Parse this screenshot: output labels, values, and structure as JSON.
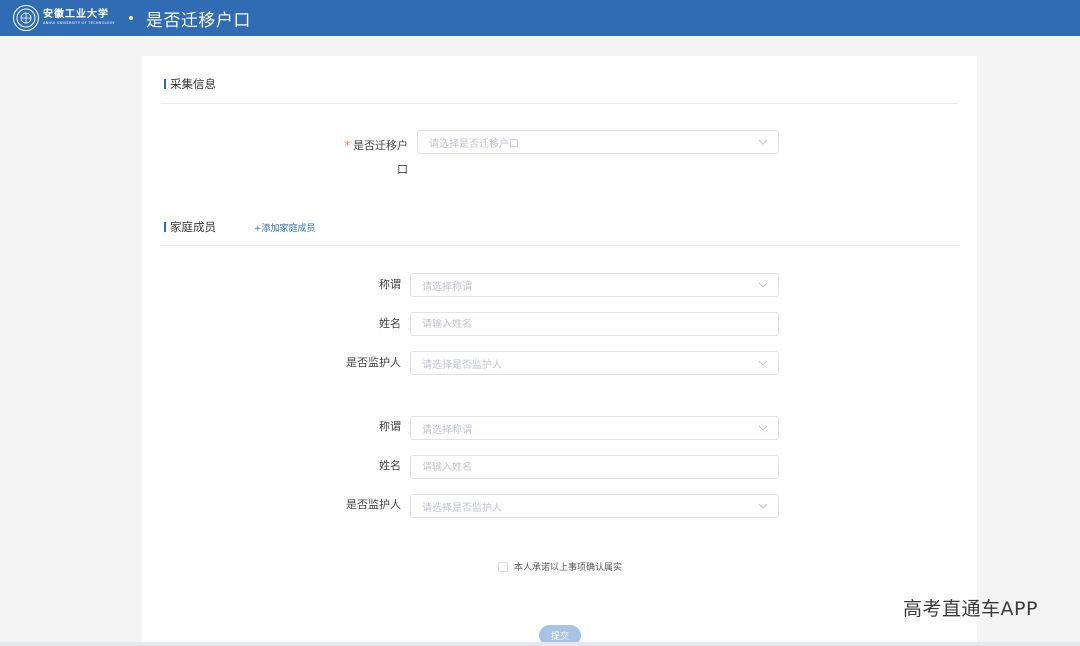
{
  "header": {
    "logo_cn": "安徽工业大学",
    "logo_en": "ANHUI UNIVERSITY OF TECHNOLOGY",
    "title": "是否迁移户口",
    "bg_color": "#2f6cb4"
  },
  "collect": {
    "section_title": "采集信息",
    "migrate_label": "是否迁移户口",
    "migrate_placeholder": "请选择是否迁移户口"
  },
  "family": {
    "section_title": "家庭成员",
    "add_link": "+添加家庭成员",
    "members": [
      {
        "relation_label": "称谓",
        "relation_placeholder": "请选择称谓",
        "name_label": "姓名",
        "name_placeholder": "请输入姓名",
        "guardian_label": "是否监护人",
        "guardian_placeholder": "请选择是否监护人"
      },
      {
        "relation_label": "称谓",
        "relation_placeholder": "请选择称谓",
        "name_label": "姓名",
        "name_placeholder": "请输入姓名",
        "guardian_label": "是否监护人",
        "guardian_placeholder": "请选择是否监护人"
      }
    ]
  },
  "agreement": {
    "text": "本人承诺以上事项确认属实",
    "checked": false
  },
  "submit_label": "提交",
  "watermark": "高考直通车APP"
}
